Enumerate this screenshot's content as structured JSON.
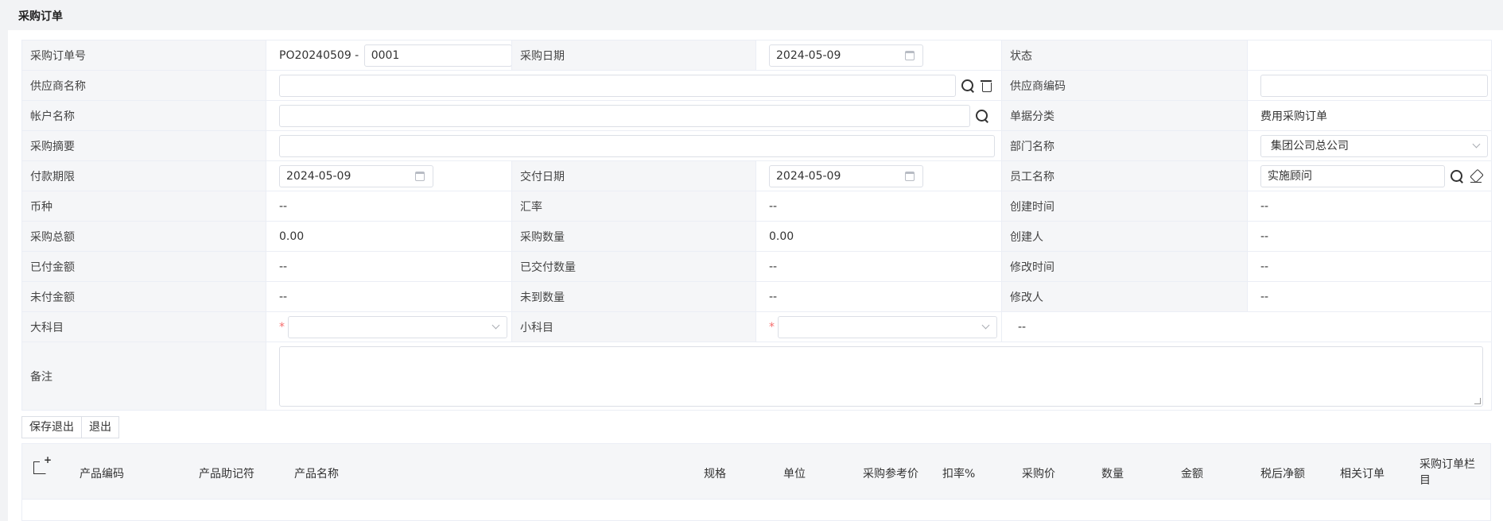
{
  "page": {
    "title": "采购订单"
  },
  "form": {
    "po_number_label": "采购订单号",
    "po_prefix": "PO20240509 -",
    "po_suffix": "0001",
    "order_date_label": "采购日期",
    "order_date": "2024-05-09",
    "status_label": "状态",
    "status_value": "",
    "supplier_name_label": "供应商名称",
    "supplier_name_value": "",
    "supplier_code_label": "供应商编码",
    "supplier_code_value": "",
    "account_name_label": "帐户名称",
    "account_name_value": "",
    "doc_category_label": "单据分类",
    "doc_category_value": "费用采购订单",
    "summary_label": "采购摘要",
    "summary_value": "",
    "dept_label": "部门名称",
    "dept_value": "集团公司总公司",
    "payment_term_label": "付款期限",
    "payment_term": "2024-05-09",
    "delivery_date_label": "交付日期",
    "delivery_date": "2024-05-09",
    "employee_label": "员工名称",
    "employee_value": "实施顾问",
    "currency_label": "币种",
    "currency_value": "--",
    "rate_label": "汇率",
    "rate_value": "--",
    "created_time_label": "创建时间",
    "created_time_value": "--",
    "total_amount_label": "采购总额",
    "total_amount_value": "0.00",
    "quantity_label": "采购数量",
    "quantity_value": "0.00",
    "creator_label": "创建人",
    "creator_value": "--",
    "paid_amount_label": "已付金额",
    "paid_amount_value": "--",
    "delivered_qty_label": "已交付数量",
    "delivered_qty_value": "--",
    "modified_time_label": "修改时间",
    "modified_time_value": "--",
    "unpaid_amount_label": "未付金额",
    "unpaid_amount_value": "--",
    "undelivered_qty_label": "未到数量",
    "undelivered_qty_value": "--",
    "modifier_label": "修改人",
    "modifier_value": "--",
    "major_subject_label": "大科目",
    "major_subject_value": "",
    "minor_subject_label": "小科目",
    "minor_subject_value": "",
    "subject_extra_value": "--",
    "remark_label": "备注",
    "required_mark": "*"
  },
  "actions": {
    "save_exit": "保存退出",
    "exit": "退出"
  },
  "grid": {
    "columns": [
      "产品编码",
      "产品助记符",
      "产品名称",
      "规格",
      "单位",
      "采购参考价",
      "扣率%",
      "采购价",
      "数量",
      "金额",
      "税后净额",
      "相关订单",
      "采购订单栏目"
    ]
  }
}
